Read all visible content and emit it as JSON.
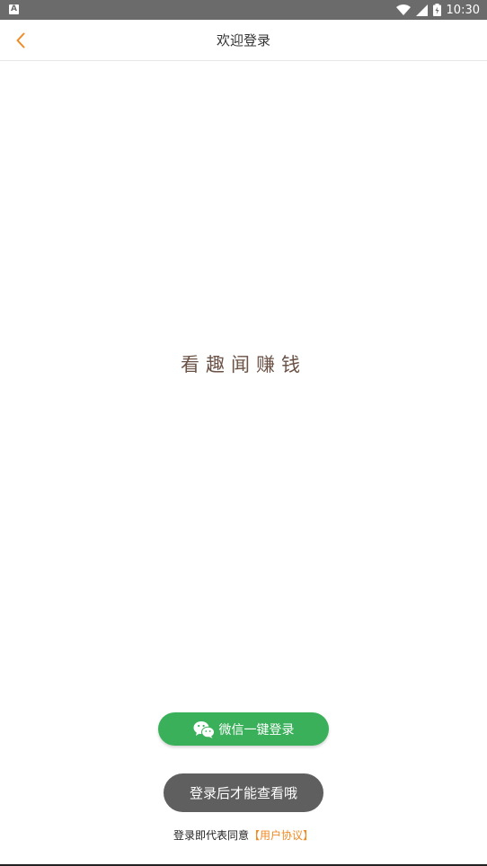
{
  "status_bar": {
    "notification_icon": "A",
    "time": "10:30",
    "icons": [
      "wifi-icon",
      "signal-icon",
      "battery-icon"
    ]
  },
  "header": {
    "title": "欢迎登录",
    "back_icon": "chevron-left-icon",
    "accent_color": "#f08a24"
  },
  "main": {
    "slogan": "看趣闻赚钱"
  },
  "login": {
    "wechat_button_label": "微信一键登录",
    "wechat_icon": "wechat-icon",
    "button_color": "#3ab05b"
  },
  "toast": {
    "message": "登录后才能查看哦"
  },
  "agreement": {
    "prefix": "登录即代表同意",
    "link_label": "【用户协议】"
  }
}
